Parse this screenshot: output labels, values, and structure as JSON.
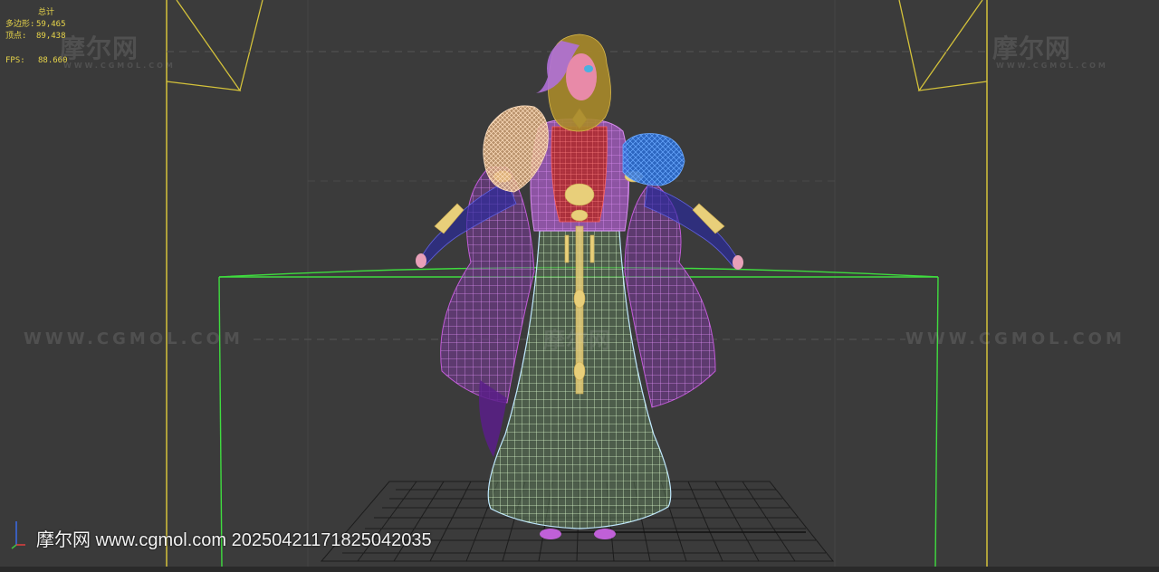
{
  "stats": {
    "header": "总计",
    "polys_label": "多边形:",
    "polys_value": "59,465",
    "verts_label": "顶点:",
    "verts_value": "89,438",
    "fps_label": "FPS:",
    "fps_value": "88.660"
  },
  "watermarks": {
    "logo": "摩尔网",
    "logo_sub": "WWW.CGMOL.COM",
    "url": "WWW.CGMOL.COM"
  },
  "footer": {
    "text": "摩尔网 www.cgmol.com 20250421171825042035"
  },
  "colors": {
    "background": "#3b3b3b",
    "stats_text": "#e8d54a",
    "frame_yellow": "#d4c23a",
    "box_green": "#3fdc3f",
    "grid": "#1c1c1c",
    "robe_purple": "#c15ad8",
    "skirt_green": "#b8f0b0",
    "torso_red": "#c83a3a",
    "gold_ornament": "#e8cf7a",
    "hair": "#a88a2a",
    "blue_fur": "#2a6fd8",
    "peach_fur": "#e8b888"
  },
  "icons": {
    "axis": "axis-gizmo-icon"
  }
}
